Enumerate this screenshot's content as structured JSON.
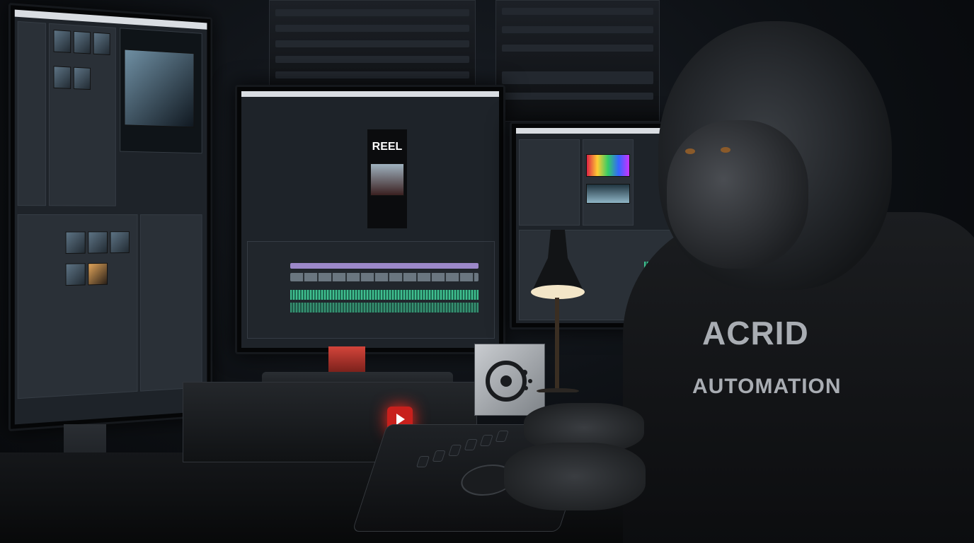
{
  "scene": {
    "description": "",
    "monitors": [
      {
        "name": "left-monitor"
      },
      {
        "name": "center-monitor",
        "preview_label": "REEL"
      },
      {
        "name": "right-monitor"
      }
    ],
    "shirt": {
      "line1": "ACRID",
      "line2": "AUTOMATION"
    },
    "colors": {
      "accent_red": "#c8201c",
      "timeline_green": "#3fbf8f",
      "timeline_purple": "#9c88c9",
      "lamp_glow": "#f3e6c8"
    }
  }
}
